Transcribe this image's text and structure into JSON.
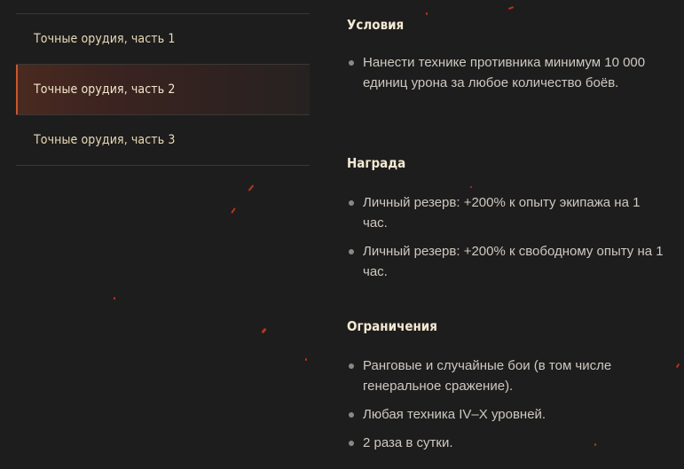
{
  "sidebar": {
    "items": [
      {
        "label": "Точные орудия, часть 1",
        "active": false
      },
      {
        "label": "Точные орудия, часть 2",
        "active": true
      },
      {
        "label": "Точные орудия, часть 3",
        "active": false
      }
    ]
  },
  "conditions": {
    "title": "Условия",
    "items": [
      "Нанести технике противника минимум 10 000 единиц урона за любое количество боёв."
    ]
  },
  "reward": {
    "title": "Награда",
    "items": [
      "Личный резерв: +200% к опыту экипажа на 1 час.",
      "Личный резерв: +200% к свободному опыту на 1 час."
    ]
  },
  "limits": {
    "title": "Ограничения",
    "items": [
      "Ранговые и случайные бои (в том числе генеральное сражение).",
      "Любая техника IV–X уровней.",
      "2 раза в сутки."
    ]
  },
  "colors": {
    "background": "#1e1d1d",
    "accent": "#d0552b",
    "heading": "#f4e9d3",
    "nav_text": "#e9d9b6"
  }
}
